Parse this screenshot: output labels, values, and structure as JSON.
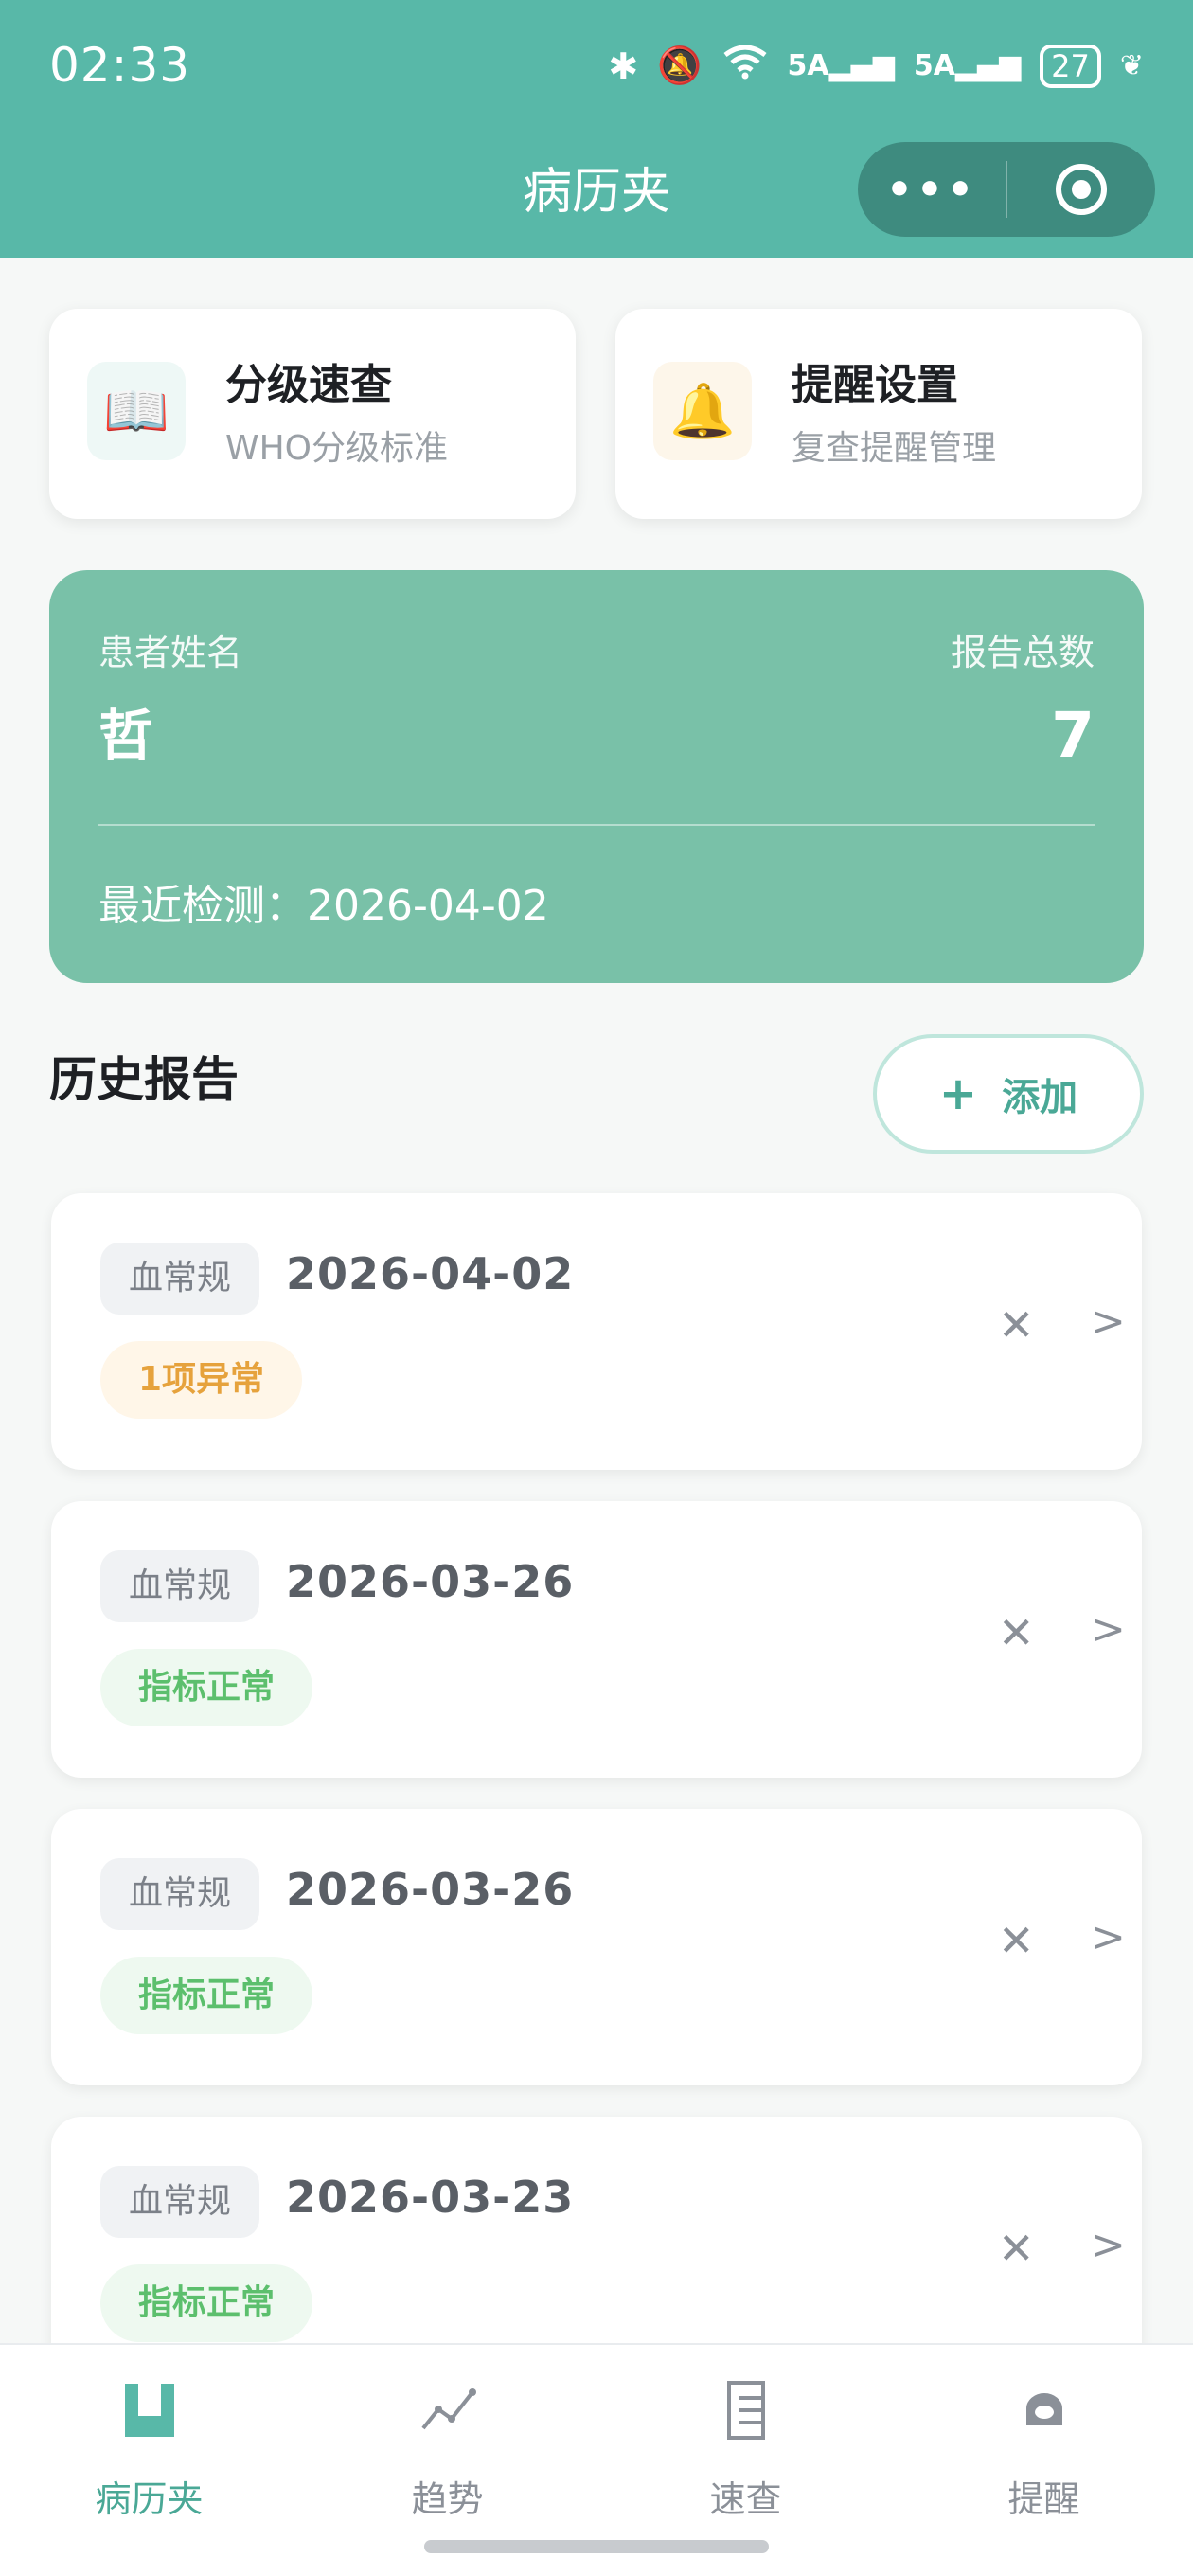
{
  "status": {
    "time": "02:33",
    "signal1": "5A",
    "signal2": "5A",
    "battery": "27"
  },
  "nav": {
    "title": "病历夹",
    "more_icon": "more-icon",
    "target_icon": "target-icon"
  },
  "quick_actions": [
    {
      "title": "分级速查",
      "subtitle": "WHO分级标准",
      "icon": "book-icon",
      "glyph": "📖"
    },
    {
      "title": "提醒设置",
      "subtitle": "复查提醒管理",
      "icon": "bell-icon",
      "glyph": "🔔"
    }
  ],
  "summary": {
    "patient_label": "患者姓名",
    "patient_name": "哲",
    "total_label": "报告总数",
    "total_value": "7",
    "recent_text": "最近检测：2026-04-02"
  },
  "history": {
    "title": "历史报告",
    "add_label": "添加",
    "reports": [
      {
        "type": "血常规",
        "date": "2026-04-02",
        "status": "1项异常",
        "status_kind": "warn"
      },
      {
        "type": "血常规",
        "date": "2026-03-26",
        "status": "指标正常",
        "status_kind": "ok"
      },
      {
        "type": "血常规",
        "date": "2026-03-26",
        "status": "指标正常",
        "status_kind": "ok"
      },
      {
        "type": "血常规",
        "date": "2026-03-23",
        "status": "指标正常",
        "status_kind": "ok"
      }
    ]
  },
  "tabs": [
    {
      "label": "病历夹",
      "icon": "folder-icon",
      "active": true
    },
    {
      "label": "趋势",
      "icon": "trend-icon",
      "active": false
    },
    {
      "label": "速查",
      "icon": "list-icon",
      "active": false
    },
    {
      "label": "提醒",
      "icon": "reminder-icon",
      "active": false
    }
  ],
  "colors": {
    "accent": "#58b8a8",
    "summary_bg": "#79c1a8",
    "warn": "#e6a23c",
    "ok": "#5cbf6d"
  }
}
